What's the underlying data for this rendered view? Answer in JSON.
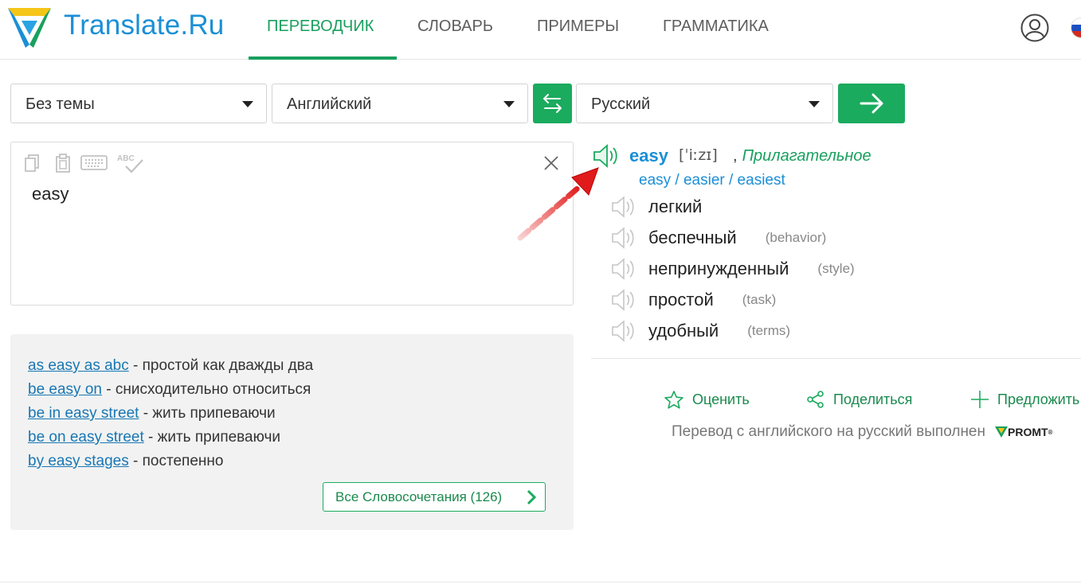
{
  "header": {
    "brand": "Translate.Ru",
    "nav": [
      {
        "label": "ПЕРЕВОДЧИК",
        "active": true
      },
      {
        "label": "СЛОВАРЬ",
        "active": false
      },
      {
        "label": "ПРИМЕРЫ",
        "active": false
      },
      {
        "label": "ГРАММАТИКА",
        "active": false
      }
    ]
  },
  "selectors": {
    "theme": "Без темы",
    "from": "Английский",
    "to": "Русский"
  },
  "input": {
    "text": "easy",
    "tools": [
      "copy-icon",
      "paste-icon",
      "keyboard-icon",
      "spellcheck-icon"
    ],
    "spellcheck_label": "ABC"
  },
  "phrases": {
    "items": [
      {
        "link": "as easy as abc",
        "text": " - простой как дважды два"
      },
      {
        "link": "be easy on",
        "text": " - снисходительно относиться"
      },
      {
        "link": "be in easy street",
        "text": " - жить припеваючи"
      },
      {
        "link": "be on easy street",
        "text": " - жить припеваючи"
      },
      {
        "link": "by easy stages",
        "text": " - постепенно"
      }
    ],
    "all_button": "Все Словосочетания (126)"
  },
  "result": {
    "word": "easy",
    "transcription": "[ˈiːzɪ]",
    "comma": ",",
    "part_of_speech": "Прилагательное",
    "forms": "easy / easier / easiest",
    "translations": [
      {
        "text": "легкий",
        "note": ""
      },
      {
        "text": "беспечный",
        "note": "(behavior)"
      },
      {
        "text": "непринужденный",
        "note": "(style)"
      },
      {
        "text": "простой",
        "note": "(task)"
      },
      {
        "text": "удобный",
        "note": "(terms)"
      }
    ]
  },
  "actions": {
    "rate": "Оценить",
    "share": "Поделиться",
    "suggest": "Предложить"
  },
  "credit": {
    "text": "Перевод с английского на русский выполнен",
    "brand": "PROMT"
  },
  "colors": {
    "accent_green": "#1aab5e",
    "link_blue": "#1a8fd6",
    "annotation_red": "#e01b1b"
  }
}
